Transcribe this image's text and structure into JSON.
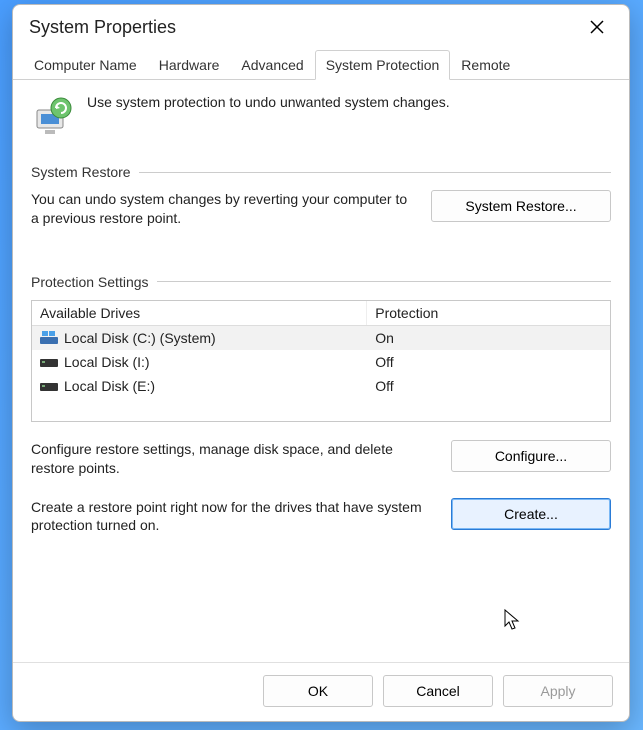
{
  "window": {
    "title": "System Properties"
  },
  "tabs": [
    {
      "label": "Computer Name",
      "active": false
    },
    {
      "label": "Hardware",
      "active": false
    },
    {
      "label": "Advanced",
      "active": false
    },
    {
      "label": "System Protection",
      "active": true
    },
    {
      "label": "Remote",
      "active": false
    }
  ],
  "intro": {
    "text": "Use system protection to undo unwanted system changes."
  },
  "restore_section": {
    "title": "System Restore",
    "text": "You can undo system changes by reverting your computer to a previous restore point.",
    "button": "System Restore..."
  },
  "protection_section": {
    "title": "Protection Settings",
    "headers": {
      "drives": "Available Drives",
      "protection": "Protection"
    },
    "rows": [
      {
        "icon": "drive-system-icon",
        "name": "Local Disk (C:) (System)",
        "protection": "On",
        "selected": true
      },
      {
        "icon": "drive-icon",
        "name": "Local Disk (I:)",
        "protection": "Off",
        "selected": false
      },
      {
        "icon": "drive-icon",
        "name": "Local Disk (E:)",
        "protection": "Off",
        "selected": false
      }
    ],
    "configure_text": "Configure restore settings, manage disk space, and delete restore points.",
    "configure_button": "Configure...",
    "create_text": "Create a restore point right now for the drives that have system protection turned on.",
    "create_button": "Create..."
  },
  "footer": {
    "ok": "OK",
    "cancel": "Cancel",
    "apply": "Apply"
  }
}
